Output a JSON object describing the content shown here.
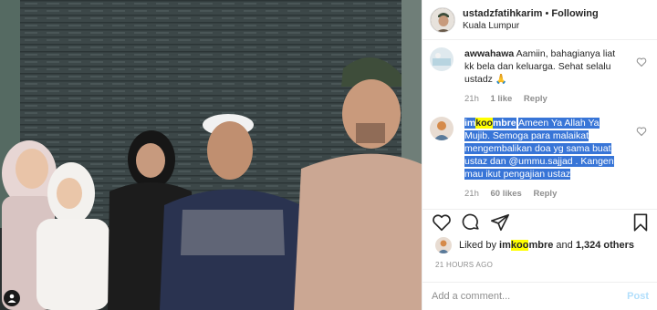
{
  "post": {
    "username": "ustadzfatihkarim",
    "separator": "•",
    "follow_status": "Following",
    "location": "Kuala Lumpur"
  },
  "comments": [
    {
      "username": "awwahawa",
      "text": "Aamiin, bahagianya liat kk bela dan keluarga. Sehat selalu ustadz 🙏",
      "time": "21h",
      "likes": "1 like",
      "reply": "Reply"
    },
    {
      "username_parts": [
        "im",
        "koo",
        "mbre"
      ],
      "text": "Ameen Ya Allah Ya Mujib. Semoga para malaikat mengembalikan doa yg sama buat ustaz dan @ummu.sajjad . Kangen mau ikut pengajian ustaz",
      "time": "21h",
      "likes": "60 likes",
      "reply": "Reply"
    }
  ],
  "likes": {
    "prefix": "Liked by",
    "user_parts": [
      "im",
      "koo",
      "mbre"
    ],
    "suffix": "and",
    "others": "1,324 others"
  },
  "timestamp": "21 HOURS AGO",
  "add_comment": {
    "placeholder": "Add a comment...",
    "post_label": "Post"
  },
  "icons": {
    "like": "heart-icon",
    "comment": "comment-icon",
    "share": "share-icon",
    "save": "bookmark-icon",
    "photo_user": "user-tag-icon"
  },
  "colors": {
    "selection": "#3875d7",
    "highlight": "#ffff00",
    "post_disabled": "#b2dffc"
  }
}
